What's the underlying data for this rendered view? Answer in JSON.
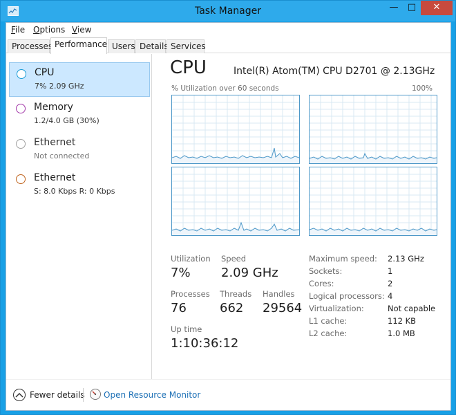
{
  "window": {
    "title": "Task Manager",
    "minimize": "—",
    "maximize": "□",
    "close": "✕"
  },
  "menu": {
    "items": [
      {
        "label": "File",
        "mnemonic": "F",
        "rest": "ile"
      },
      {
        "label": "Options",
        "mnemonic": "O",
        "rest": "ptions"
      },
      {
        "label": "View",
        "mnemonic": "V",
        "rest": "iew"
      }
    ]
  },
  "tabs": [
    {
      "label": "Processes"
    },
    {
      "label": "Performance",
      "active": true
    },
    {
      "label": "Users"
    },
    {
      "label": "Details"
    },
    {
      "label": "Services"
    }
  ],
  "sidebar": {
    "items": [
      {
        "name": "CPU",
        "sub": "7%  2.09 GHz",
        "dot_color": "#1a9cd6",
        "selected": true
      },
      {
        "name": "Memory",
        "sub": "1.2/4.0 GB (30%)",
        "dot_color": "#a238a8"
      },
      {
        "name": "Ethernet",
        "sub": "Not connected",
        "dot_color": "#a0a0a0"
      },
      {
        "name": "Ethernet",
        "sub": "S: 8.0 Kbps  R: 0 Kbps",
        "dot_color": "#c0641e"
      }
    ]
  },
  "cpu": {
    "title": "CPU",
    "model": "Intel(R) Atom(TM) CPU D2701 @ 2.13GHz",
    "graph_caption": "% Utilization over 60 seconds",
    "graph_max": "100%",
    "stats": {
      "utilization_label": "Utilization",
      "utilization": "7%",
      "speed_label": "Speed",
      "speed": "2.09 GHz",
      "processes_label": "Processes",
      "processes": "76",
      "threads_label": "Threads",
      "threads": "662",
      "handles_label": "Handles",
      "handles": "29564",
      "uptime_label": "Up time",
      "uptime": "1:10:36:12"
    },
    "details": [
      {
        "label": "Maximum speed:",
        "value": "2.13 GHz"
      },
      {
        "label": "Sockets:",
        "value": "1"
      },
      {
        "label": "Cores:",
        "value": "2"
      },
      {
        "label": "Logical processors:",
        "value": "4"
      },
      {
        "label": "Virtualization:",
        "value": "Not capable"
      },
      {
        "label": "L1 cache:",
        "value": "112 KB"
      },
      {
        "label": "L2 cache:",
        "value": "1.0 MB"
      }
    ]
  },
  "footer": {
    "fewer_details": "Fewer details",
    "fewer_mnemonic": "d",
    "open_resource_monitor": "Open Resource Monitor"
  },
  "colors": {
    "accent": "#1a9cd6",
    "graph_line": "#4d98c8",
    "link": "#1b6fb5",
    "selected_bg": "#cce8ff"
  }
}
